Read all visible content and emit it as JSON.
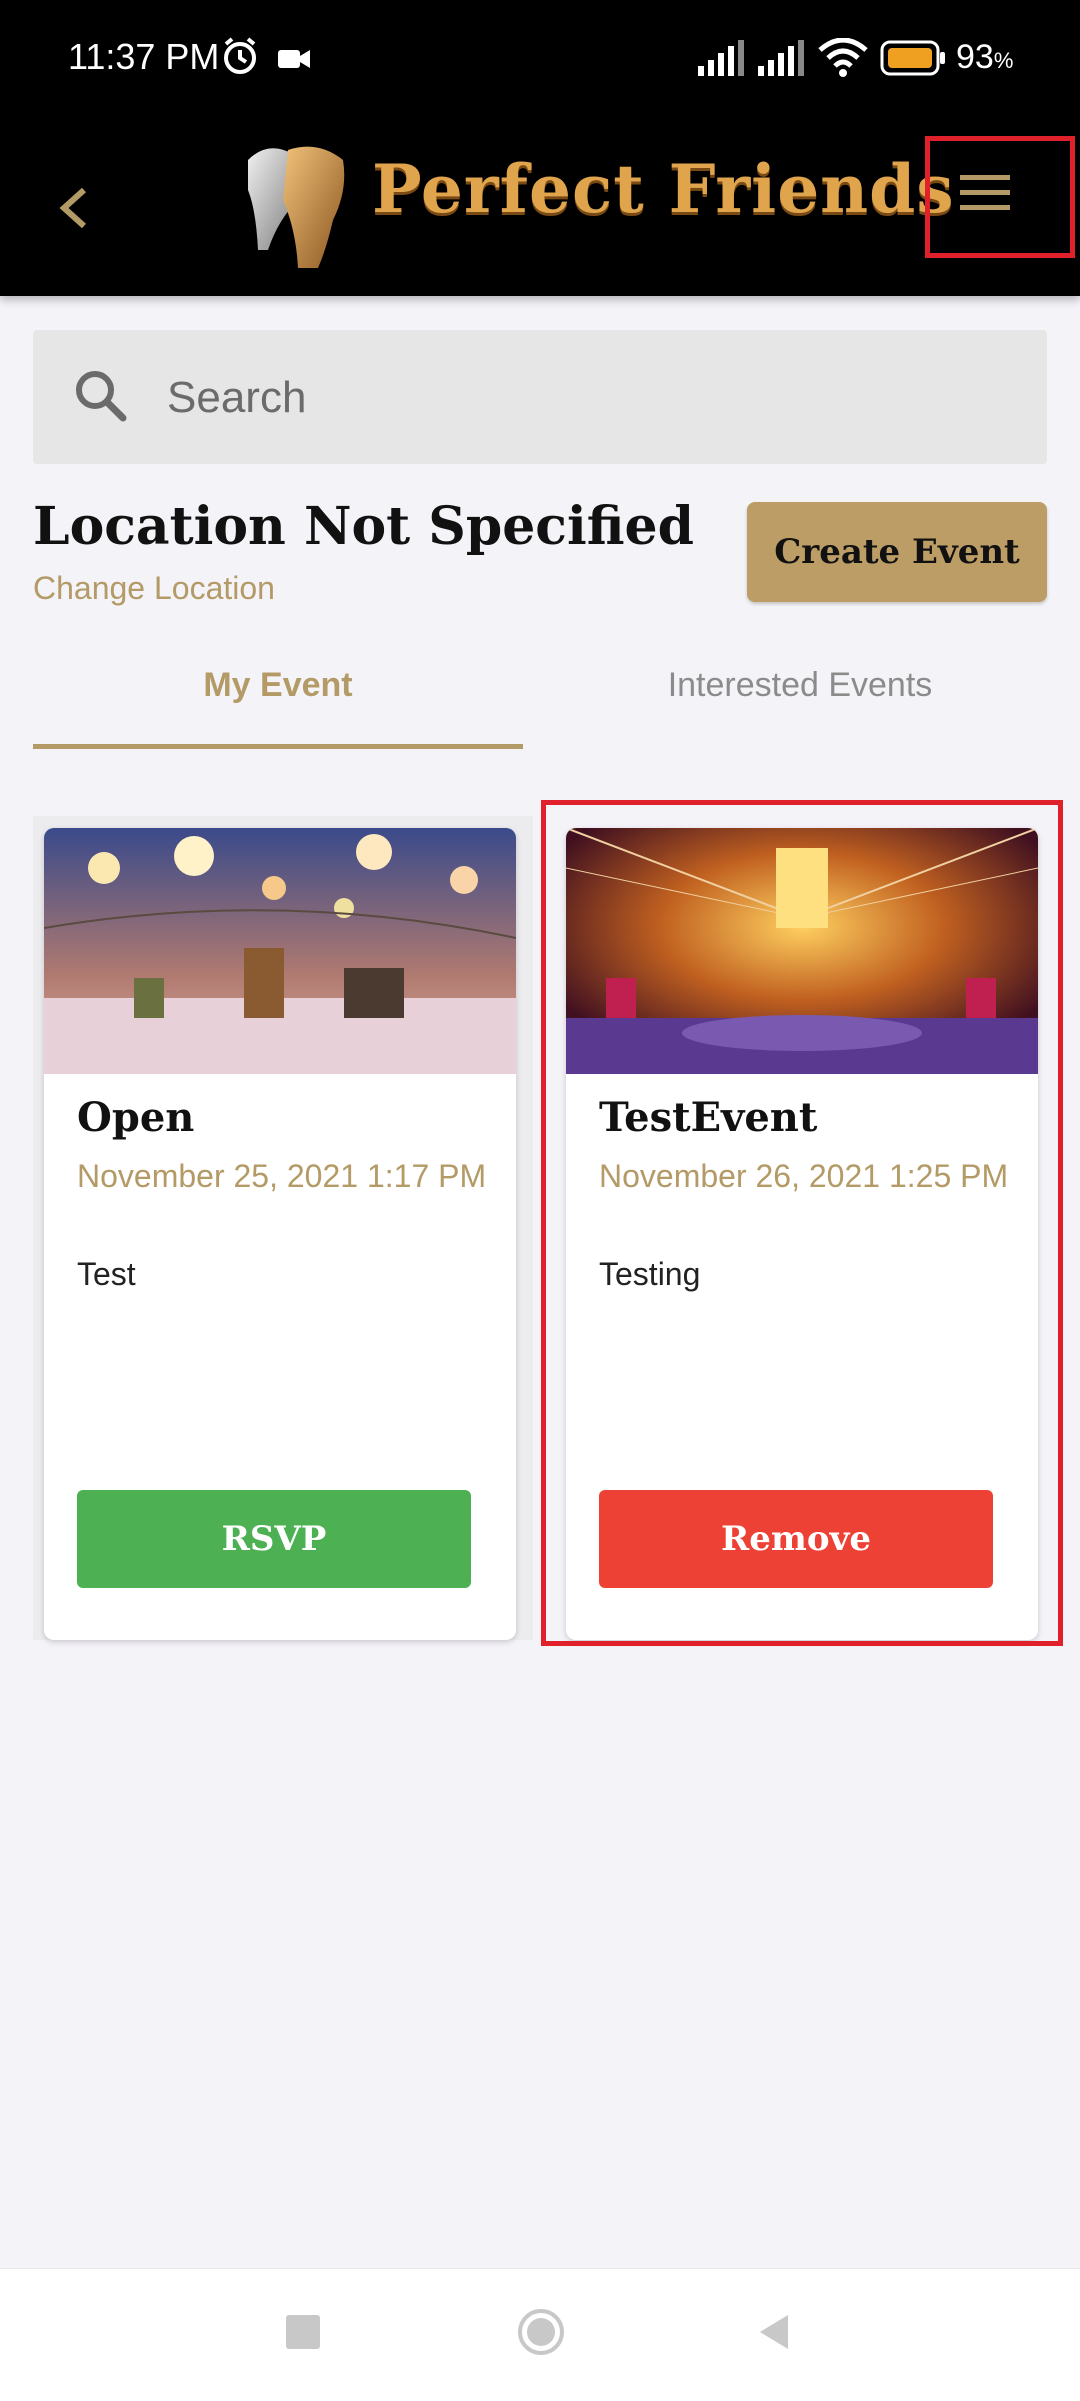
{
  "status_bar": {
    "time": "11:37 PM",
    "battery_percent": "93",
    "battery_unit": "%",
    "icons": [
      "alarm-icon",
      "video-camera-icon",
      "signal-icon",
      "signal-icon",
      "wifi-icon",
      "battery-icon"
    ]
  },
  "app_bar": {
    "title": "Perfect Friends",
    "back_icon": "chevron-left-icon",
    "menu_icon": "hamburger-menu-icon"
  },
  "search": {
    "placeholder": "Search"
  },
  "location": {
    "title": "Location Not Specified",
    "change_link": "Change Location"
  },
  "create_event_label": "Create Event",
  "tabs": [
    {
      "label": "My Event",
      "active": true
    },
    {
      "label": "Interested Events",
      "active": false
    }
  ],
  "events": [
    {
      "title": "Open",
      "date": "November 25, 2021 1:17 PM",
      "description": "Test",
      "button_label": "RSVP"
    },
    {
      "title": "TestEvent",
      "date": "November 26, 2021 1:25 PM",
      "description": "Testing",
      "button_label": "Remove"
    }
  ],
  "colors": {
    "accent_gold": "#b39a66",
    "create_button": "#bb9d65",
    "rsvp_green": "#4db153",
    "remove_red": "#ee4135",
    "highlight_red": "#e0202a"
  },
  "nav_bar": {
    "icons": [
      "recents-square-icon",
      "home-circle-icon",
      "back-triangle-icon"
    ]
  }
}
